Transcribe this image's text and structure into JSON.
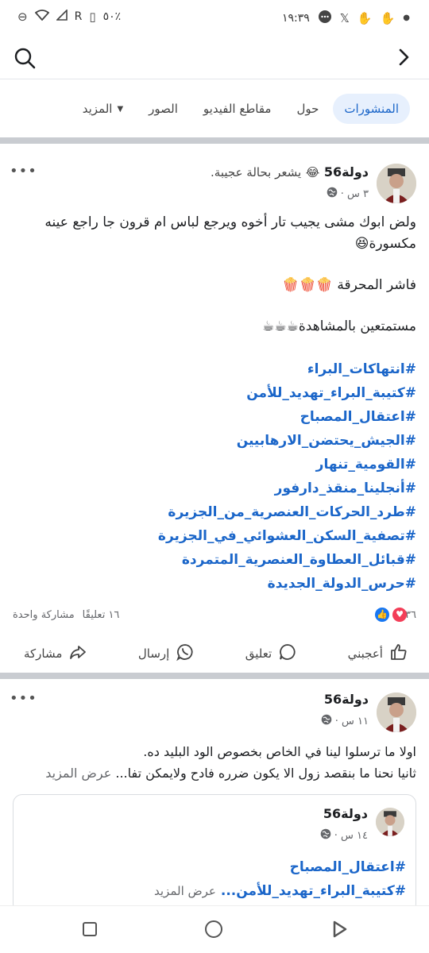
{
  "status_bar": {
    "time": "١٩:٣٩",
    "battery": "٥٠٪",
    "network": "R"
  },
  "tabs": [
    {
      "label": "المنشورات",
      "active": true
    },
    {
      "label": "حول",
      "active": false
    },
    {
      "label": "مقاطع الفيديو",
      "active": false
    },
    {
      "label": "الصور",
      "active": false
    },
    {
      "label": "المزيد",
      "active": false
    }
  ],
  "post1": {
    "author": "دولة56",
    "feeling": "يشعر بحالة عجيبة.",
    "feeling_emoji": "😂",
    "time": "٣ س ·",
    "line1": "ولض ابوك مشى يجيب تار أخوه ويرجع  لباس ام قرون جا راجع عينه مكسورة😆",
    "line2": "فاشر المحرقة 🍿🍿🍿",
    "line3": "مستمتعين بالمشاهدة☕☕☕",
    "hashtags": [
      "#انتهاكات_البراء",
      "#كتيبة_البراء_تهديد_للأمن",
      "#اعتقال_المصباح",
      "#الجيش_يحتضن_الارهابيين",
      "#القومية_تنهار",
      "#أنجلينا_منقذ_دارفور",
      "#طرد_الحركات_العنصرية_من_الجزيرة",
      "#تصفية_السكن_العشوائي_في_الجزيرة",
      "#قبائل_العطاوة_العنصرية_المتمردة",
      "#حرس_الدولة_الجديدة"
    ],
    "reactions_count": "٣٦",
    "comments": "١٦ تعليقًا",
    "shares": "مشاركة واحدة",
    "actions": {
      "like": "أعجبني",
      "comment": "تعليق",
      "send": "إرسال",
      "share": "مشاركة"
    }
  },
  "post2": {
    "author": "دولة56",
    "time": "١١ س ·",
    "line1": "اولا ما ترسلوا لينا في الخاص بخصوص الود البليد ده.",
    "line2": "ثانيا نحنا ما بنقصد زول الا يكون ضرره فادح ولايمكن تفا...",
    "see_more": "عرض المزيد",
    "shared": {
      "author": "دولة56",
      "time": "١٤ س ·",
      "hashtag1": "#اعتقال_المصباح",
      "hashtag2": "#كتيبة_البراء_تهديد_للأمن...",
      "see_more": "عرض المزيد"
    }
  },
  "colors": {
    "accent": "#1b66c9",
    "like_blue": "#1877f2",
    "love_red": "#f33e58"
  }
}
